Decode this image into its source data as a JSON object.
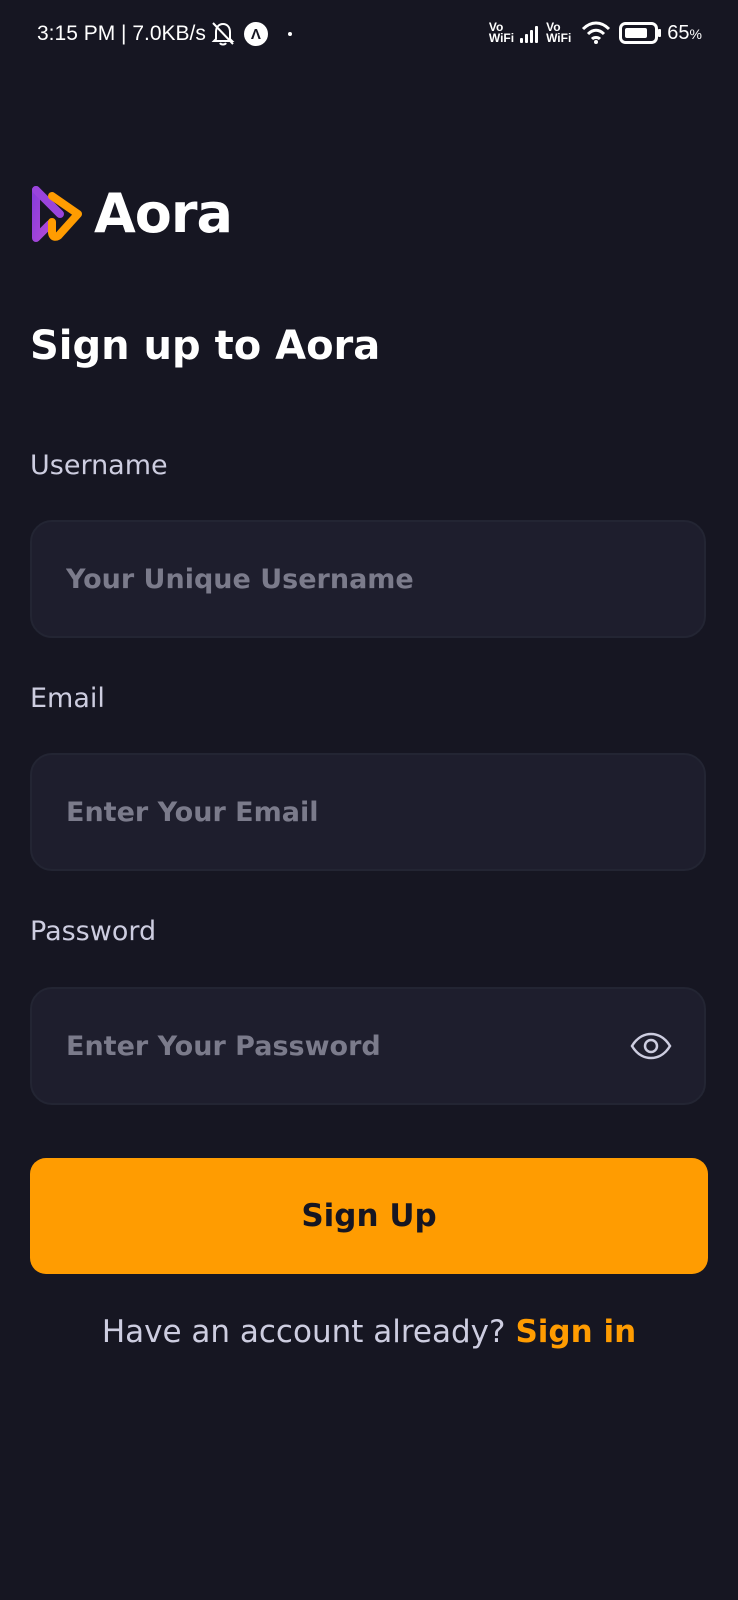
{
  "status_bar": {
    "time_speed": "3:15 PM | 7.0KB/s",
    "vowifi_top": "Vo",
    "vowifi_bottom": "WiFi",
    "battery_percent": "65",
    "battery_unit": "%"
  },
  "app": {
    "name": "Aora",
    "logo_colors": [
      "#8b3ddb",
      "#ff9c01"
    ]
  },
  "page": {
    "title": "Sign up to Aora"
  },
  "form": {
    "username_label": "Username",
    "username_placeholder": "Your Unique Username",
    "email_label": "Email",
    "email_placeholder": "Enter Your Email",
    "password_label": "Password",
    "password_placeholder": "Enter Your Password",
    "password_toggle_icon": "eye-icon",
    "submit_label": "Sign Up"
  },
  "footer": {
    "prompt": "Have an account already?",
    "link": "Sign in"
  },
  "colors": {
    "background": "#161622",
    "field_background": "#1e1e2d",
    "accent": "#ff9c01"
  }
}
